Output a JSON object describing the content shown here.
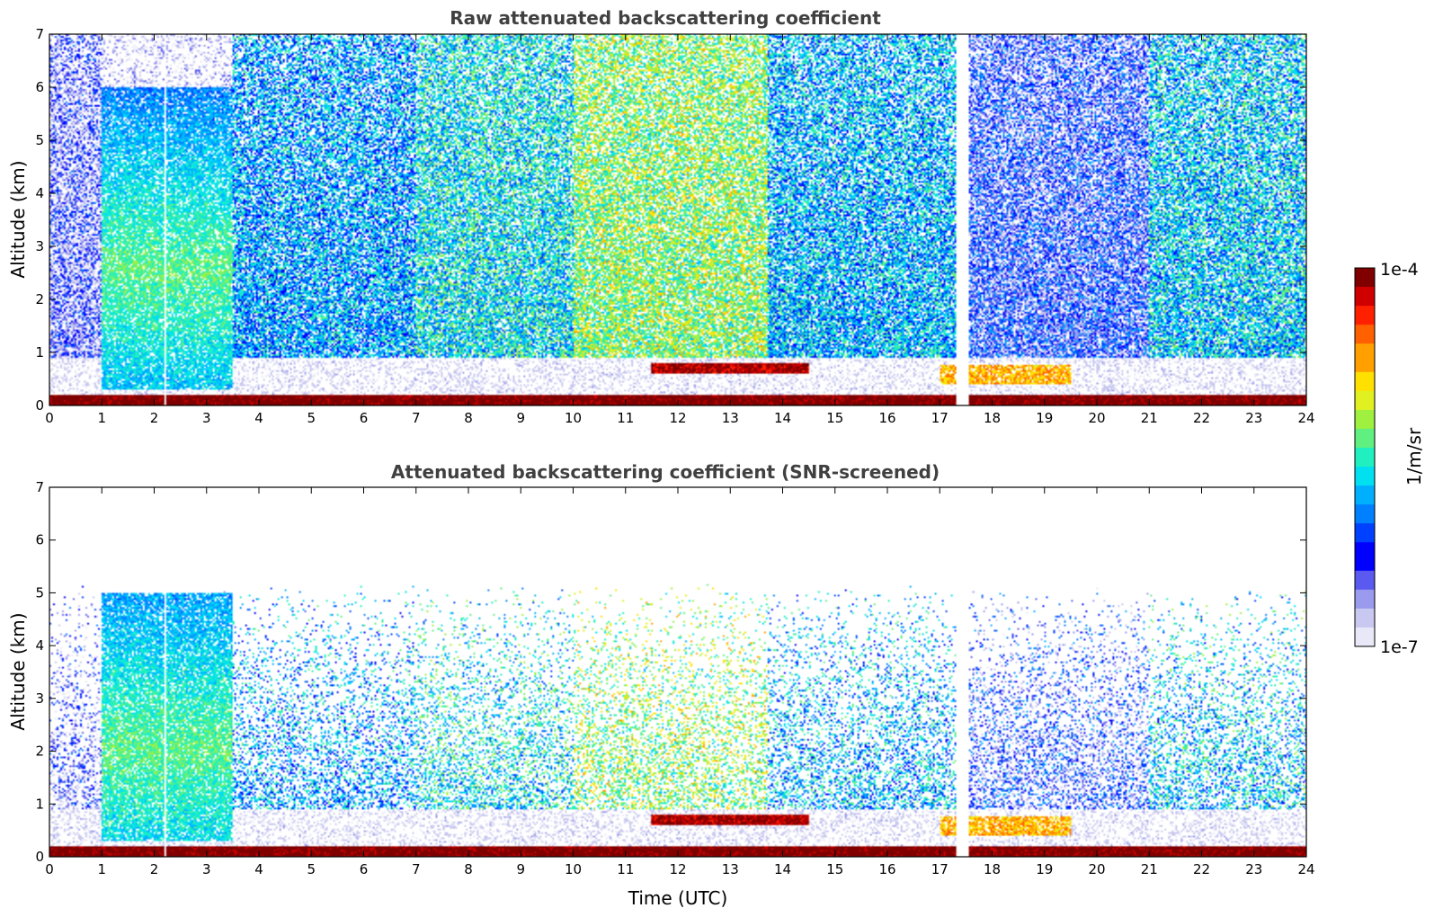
{
  "colormap": [
    "#e8e8f8",
    "#c8c8f0",
    "#9a9aee",
    "#5a5af0",
    "#0000ff",
    "#0040ff",
    "#0080ff",
    "#00b0ff",
    "#00e0f0",
    "#20f0c0",
    "#60f080",
    "#a0f040",
    "#e0f020",
    "#ffe000",
    "#ffa000",
    "#ff6000",
    "#ff2000",
    "#d00000",
    "#800000"
  ],
  "chart_data": [
    {
      "type": "heatmap",
      "title": "Raw attenuated backscattering coefficient",
      "xlabel": "",
      "ylabel": "Altitude (km)",
      "xlim": [
        0,
        24
      ],
      "ylim": [
        0,
        7
      ],
      "xticks": [
        "0",
        "1",
        "2",
        "3",
        "4",
        "5",
        "6",
        "7",
        "8",
        "9",
        "10",
        "11",
        "12",
        "13",
        "14",
        "15",
        "16",
        "17",
        "18",
        "19",
        "20",
        "21",
        "22",
        "23",
        "24"
      ],
      "yticks": [
        "0",
        "1",
        "2",
        "3",
        "4",
        "5",
        "6",
        "7"
      ],
      "features": [
        {
          "x": [
            1.0,
            3.5
          ],
          "y": [
            0.3,
            6.0
          ],
          "level": 0.55
        },
        {
          "x": [
            11.5,
            14.5
          ],
          "y": [
            0.6,
            0.8
          ],
          "level": 0.95
        },
        {
          "x": [
            17.0,
            19.5
          ],
          "y": [
            0.4,
            0.75
          ],
          "level": 0.75
        },
        {
          "x": [
            0,
            24
          ],
          "y": [
            0.0,
            0.2
          ],
          "level": 1.0
        }
      ]
    },
    {
      "type": "heatmap",
      "title": "Attenuated backscattering coefficient (SNR-screened)",
      "xlabel": "Time (UTC)",
      "ylabel": "Altitude (km)",
      "xlim": [
        0,
        24
      ],
      "ylim": [
        0,
        7
      ],
      "xticks": [
        "0",
        "1",
        "2",
        "3",
        "4",
        "5",
        "6",
        "7",
        "8",
        "9",
        "10",
        "11",
        "12",
        "13",
        "14",
        "15",
        "16",
        "17",
        "18",
        "19",
        "20",
        "21",
        "22",
        "23",
        "24"
      ],
      "yticks": [
        "0",
        "1",
        "2",
        "3",
        "4",
        "5",
        "6",
        "7"
      ],
      "features": [
        {
          "x": [
            1.0,
            3.5
          ],
          "y": [
            0.3,
            5.0
          ],
          "level": 0.55
        },
        {
          "x": [
            11.5,
            14.5
          ],
          "y": [
            0.6,
            0.8
          ],
          "level": 0.95
        },
        {
          "x": [
            17.0,
            19.5
          ],
          "y": [
            0.4,
            0.75
          ],
          "level": 0.75
        },
        {
          "x": [
            0,
            24
          ],
          "y": [
            0.0,
            0.2
          ],
          "level": 1.0
        }
      ]
    }
  ],
  "colorbar": {
    "label": "1/m/sr",
    "max_label": "1e-4",
    "min_label": "1e-7",
    "range": [
      1e-07,
      0.0001
    ],
    "scale": "log"
  }
}
